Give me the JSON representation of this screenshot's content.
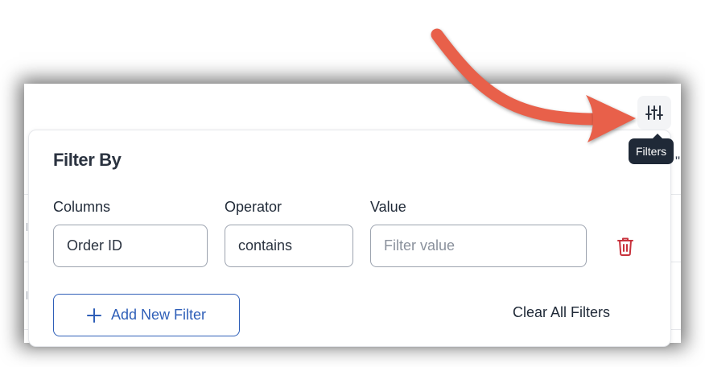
{
  "toolbar": {
    "filter_icon": "sliders-icon",
    "tooltip": "Filters"
  },
  "popover": {
    "title": "Filter By",
    "labels": {
      "columns": "Columns",
      "operator": "Operator",
      "value": "Value"
    },
    "filter_row": {
      "column": "Order ID",
      "operator": "contains",
      "value": "",
      "value_placeholder": "Filter value",
      "delete_icon": "trash-icon"
    },
    "add_filter_label": "Add New Filter",
    "add_filter_icon": "plus-icon",
    "clear_label": "Clear All Filters"
  },
  "colors": {
    "primary": "#2f5fb8",
    "danger": "#c8323c",
    "annotation_arrow": "#e8604a",
    "tooltip_bg": "#1f2937"
  }
}
